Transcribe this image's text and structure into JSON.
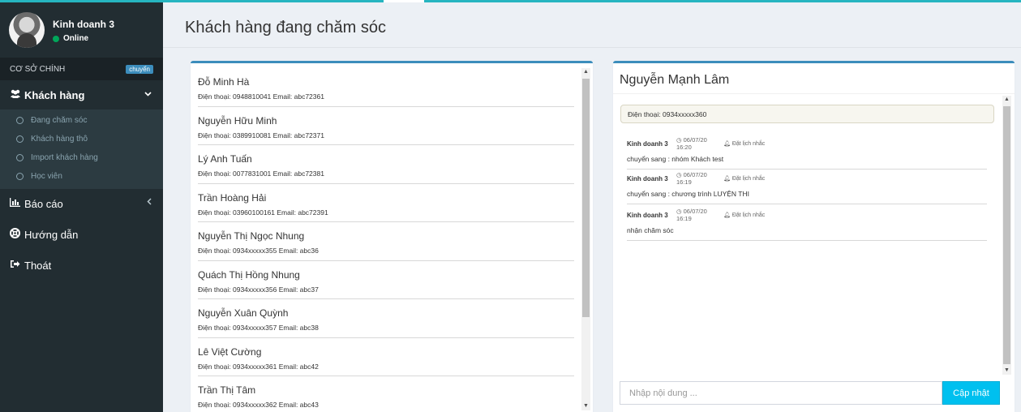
{
  "user": {
    "name": "Kinh doanh 3",
    "status": "Online"
  },
  "branch": {
    "label": "CƠ SỞ CHÍNH",
    "badge": "chuyển"
  },
  "menu": {
    "customers": {
      "label": "Khách hàng",
      "icon": "users-icon"
    },
    "sub_items": [
      "Đang chăm sóc",
      "Khách hàng thô",
      "Import khách hàng",
      "Học viên"
    ],
    "reports": {
      "label": "Báo cáo",
      "icon": "bar-chart-icon"
    },
    "guide": {
      "label": "Hướng dẫn",
      "icon": "life-ring-icon"
    },
    "logout": {
      "label": "Thoát",
      "icon": "sign-out-icon"
    }
  },
  "page": {
    "title": "Khách hàng đang chăm sóc"
  },
  "customers": [
    {
      "name": "Đỗ Minh Hà",
      "meta": "Điện thoại: 0948810041 Email: abc72361"
    },
    {
      "name": "Nguyễn Hữu Minh",
      "meta": "Điện thoại: 0389910081 Email: abc72371"
    },
    {
      "name": "Lý Anh Tuấn",
      "meta": "Điện thoại: 0077831001 Email: abc72381"
    },
    {
      "name": "Trần Hoàng Hải",
      "meta": "Điện thoại: 03960100161 Email: abc72391"
    },
    {
      "name": "Nguyễn Thị Ngọc Nhung",
      "meta": "Điện thoại: 0934xxxxx355 Email: abc36"
    },
    {
      "name": "Quách Thị Hồng Nhung",
      "meta": "Điện thoại: 0934xxxxx356 Email: abc37"
    },
    {
      "name": "Nguyễn Xuân Quỳnh",
      "meta": "Điện thoại: 0934xxxxx357 Email: abc38"
    },
    {
      "name": "Lê Việt Cường",
      "meta": "Điện thoại: 0934xxxxx361 Email: abc42"
    },
    {
      "name": "Trần Thị Tâm",
      "meta": "Điện thoại: 0934xxxxx362 Email: abc43"
    }
  ],
  "detail": {
    "name": "Nguyễn Mạnh Lâm",
    "phone": "Điện thoại: 0934xxxxx360",
    "history": [
      {
        "author": "Kinh doanh 3",
        "time": "06/07/20 16:20",
        "remind": "Đặt lịch nhắc",
        "text": "chuyển sang : nhóm Khách test"
      },
      {
        "author": "Kinh doanh 3",
        "time": "06/07/20 16:19",
        "remind": "Đặt lịch nhắc",
        "text": "chuyển sang : chương trình LUYỆN THI"
      },
      {
        "author": "Kinh doanh 3",
        "time": "06/07/20 16:19",
        "remind": "Đặt lịch nhắc",
        "text": "nhận chăm sóc"
      }
    ],
    "input_placeholder": "Nhập nội dung ...",
    "update_label": "Cập nhật"
  },
  "colors": {
    "sidebar": "#222d32",
    "accent": "#3c8dbc",
    "button": "#00c0ef",
    "online": "#00a65a",
    "topline": "#26b5c0"
  }
}
